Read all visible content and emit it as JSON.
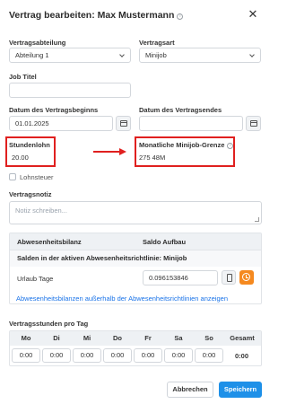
{
  "dialog": {
    "title": "Vertrag bearbeiten: Max Mustermann",
    "info_glyph": "i",
    "close_glyph": "✕"
  },
  "form": {
    "abteilung": {
      "label": "Vertragsabteilung",
      "value": "Abteilung 1"
    },
    "vertragsart": {
      "label": "Vertragsart",
      "value": "Minijob"
    },
    "job_titel": {
      "label": "Job Titel",
      "value": ""
    },
    "beginn": {
      "label": "Datum des Vertragsbeginns",
      "value": "01.01.2025"
    },
    "ende": {
      "label": "Datum des Vertragsendes",
      "value": ""
    },
    "stundenlohn": {
      "label": "Stundenlohn",
      "value": "20.00"
    },
    "grenze": {
      "label": "Monatliche Minijob-Grenze",
      "value": "275 48M"
    },
    "lohnsteuer": {
      "label": "Lohnsteuer",
      "checked": false
    },
    "notiz": {
      "label": "Vertragsnotiz",
      "placeholder": "Notiz schreiben..."
    }
  },
  "absence": {
    "col1": "Abwesenheitsbilanz",
    "col2": "Saldo Aufbau",
    "section": "Salden in der aktiven Abwesenheitsrichtlinie: Minijob",
    "row_label": "Urlaub Tage",
    "row_value": "0.096153846",
    "link": "Abwesenheitsbilanzen außerhalb der Abwesenheitsrichtlinien anzeigen"
  },
  "weekly": {
    "label": "Vertragsstunden pro Tag",
    "days": [
      "Mo",
      "Di",
      "Mi",
      "Do",
      "Fr",
      "Sa",
      "So"
    ],
    "values": [
      "0:00",
      "0:00",
      "0:00",
      "0:00",
      "0:00",
      "0:00",
      "0:00"
    ],
    "total_label": "Gesamt",
    "total_value": "0:00"
  },
  "buttons": {
    "cancel": "Abbrechen",
    "save": "Speichern"
  },
  "colors": {
    "accent": "#1e90e8",
    "highlight": "#e0201f",
    "orange": "#f5891f"
  }
}
